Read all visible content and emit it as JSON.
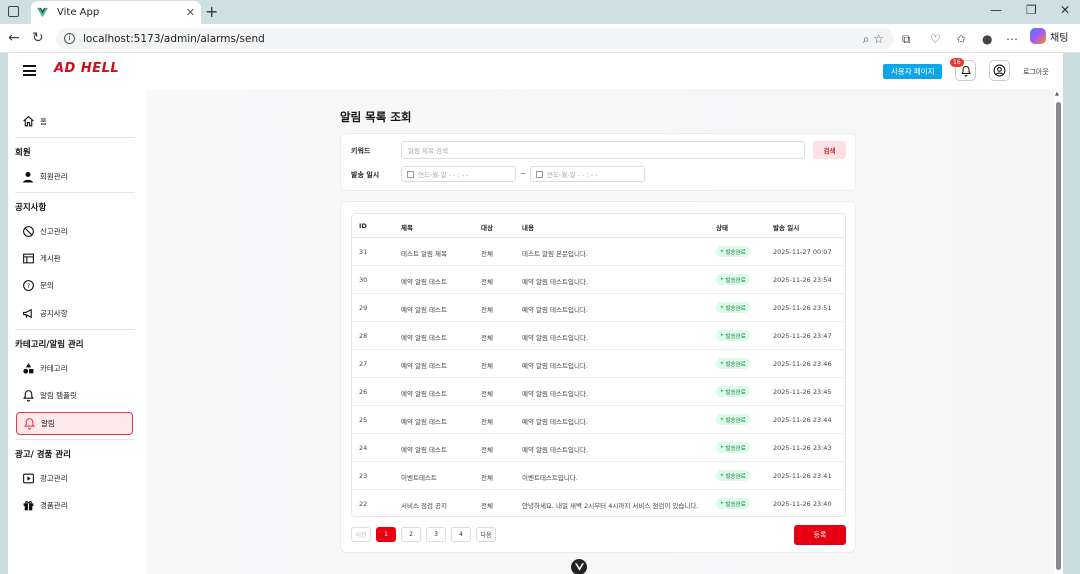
{
  "browser": {
    "tab_title": "Vite App",
    "url": "localhost:5173/admin/alarms/send",
    "copilot_label": "채팅"
  },
  "header": {
    "logo": "AD HELL",
    "user_page_button": "사용자 페이지",
    "notification_count": "16",
    "logout": "로그아웃"
  },
  "sidebar": {
    "home": "홈",
    "groups": {
      "member": "회원",
      "notice": "공지사항",
      "category_alarm": "카테고리/알림 관리",
      "ad_prize": "광고/ 경품 관리"
    },
    "items": {
      "member_manage": "회원관리",
      "report_manage": "신고관리",
      "board": "게시판",
      "inquiry": "문의",
      "notice": "공지사항",
      "category": "카테고리",
      "alarm_template": "알림 템플릿",
      "alarm": "알림",
      "ad_manage": "광고관리",
      "prize_manage": "경품관리"
    }
  },
  "page": {
    "title": "알림 목록 조회",
    "filters": {
      "keyword_label": "키워드",
      "keyword_placeholder": "알림 제목 검색",
      "search_button": "검색",
      "date_label": "발송 일시",
      "date_from_placeholder": "연도-월-일 - - : - -",
      "date_to_placeholder": "연도-월-일 - - : - -",
      "tilde": "~"
    },
    "table": {
      "headers": [
        "ID",
        "제목",
        "대상",
        "내용",
        "상태",
        "발송 일시"
      ],
      "rows": [
        {
          "id": "31",
          "title": "테스트 알림 제목",
          "target": "전체",
          "content": "테스트 알림 본문입니다.",
          "status": "발송완료",
          "sent_at": "2025-11-27 00:07"
        },
        {
          "id": "30",
          "title": "예약 알림 테스트",
          "target": "전체",
          "content": "예약 알림 테스트입니다.",
          "status": "발송완료",
          "sent_at": "2025-11-26 23:54"
        },
        {
          "id": "29",
          "title": "예약 알림 테스트",
          "target": "전체",
          "content": "예약 알림 테스트입니다.",
          "status": "발송완료",
          "sent_at": "2025-11-26 23:51"
        },
        {
          "id": "28",
          "title": "예약 알림 테스트",
          "target": "전체",
          "content": "예약 알림 테스트입니다.",
          "status": "발송완료",
          "sent_at": "2025-11-26 23:47"
        },
        {
          "id": "27",
          "title": "예약 알림 테스트",
          "target": "전체",
          "content": "예약 알림 테스트입니다.",
          "status": "발송완료",
          "sent_at": "2025-11-26 23:46"
        },
        {
          "id": "26",
          "title": "예약 알림 테스트",
          "target": "전체",
          "content": "예약 알림 테스트입니다.",
          "status": "발송완료",
          "sent_at": "2025-11-26 23:45"
        },
        {
          "id": "25",
          "title": "예약 알림 테스트",
          "target": "전체",
          "content": "예약 알림 테스트입니다.",
          "status": "발송완료",
          "sent_at": "2025-11-26 23:44"
        },
        {
          "id": "24",
          "title": "예약 알림 테스트",
          "target": "전체",
          "content": "예약 알림 테스트입니다.",
          "status": "발송완료",
          "sent_at": "2025-11-26 23:43"
        },
        {
          "id": "23",
          "title": "이벤트테스트",
          "target": "전체",
          "content": "이벤트테스트입니다.",
          "status": "발송완료",
          "sent_at": "2025-11-26 23:41"
        },
        {
          "id": "22",
          "title": "서비스 점검 공지",
          "target": "전체",
          "content": "안녕하세요, 내일 새벽 2시부터 4시까지 서비스 점검이 있습니다.",
          "status": "발송완료",
          "sent_at": "2025-11-26 23:40"
        }
      ]
    },
    "pagination": {
      "prev": "이전",
      "pages": [
        "1",
        "2",
        "3",
        "4"
      ],
      "current": "1",
      "next": "다음"
    },
    "register_button": "등록"
  },
  "colors": {
    "brand_red": "#e60012",
    "accent_blue": "#0ea5e9",
    "status_green": "#15803d"
  }
}
